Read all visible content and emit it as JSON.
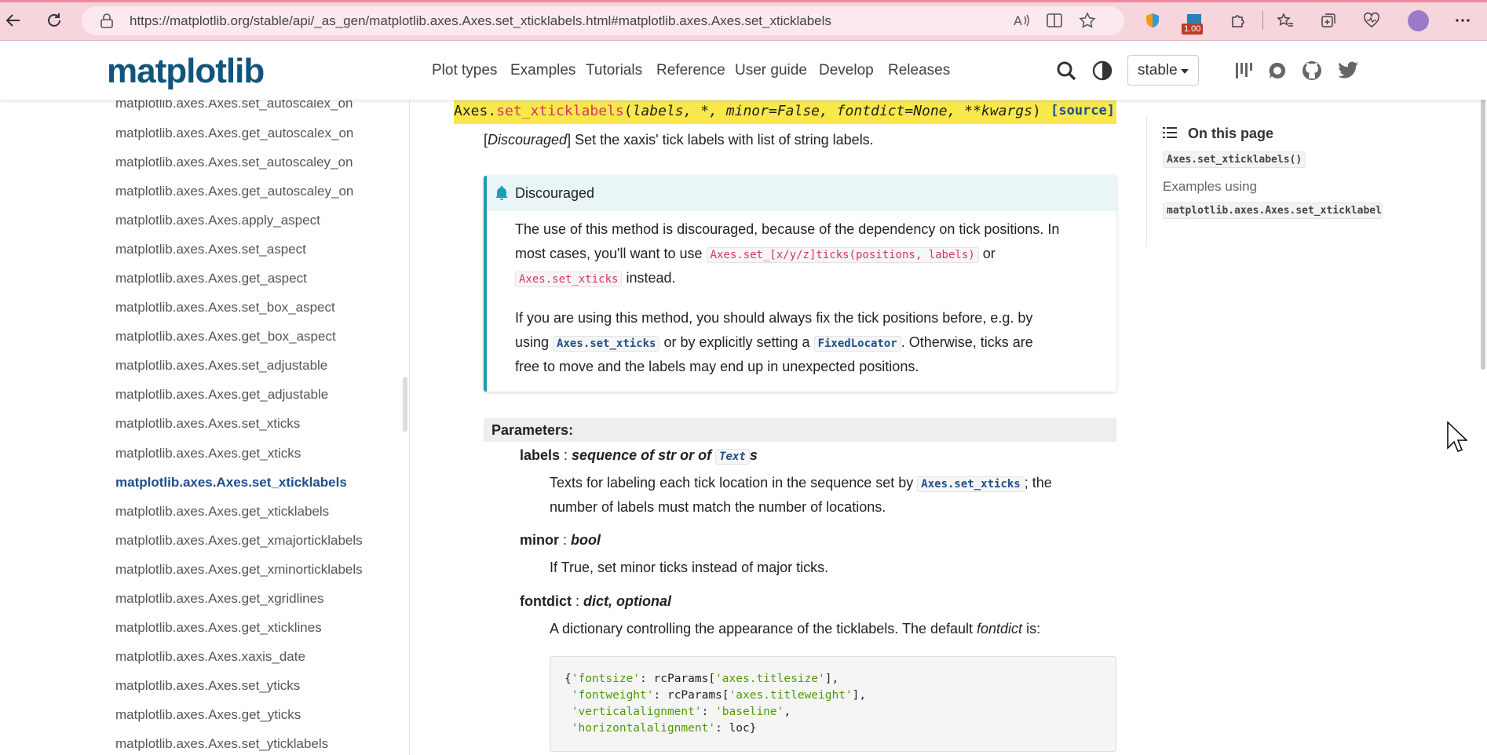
{
  "browser": {
    "url": "https://matplotlib.org/stable/api/_as_gen/matplotlib.axes.Axes.set_xticklabels.html#matplotlib.axes.Axes.set_xticklabels",
    "ext_badge": "1.00",
    "colors": {
      "chrome": "#f6d5dc",
      "accent": "#ee8aa0"
    }
  },
  "header": {
    "logo": "matplotlib",
    "nav": [
      "Plot types",
      "Examples",
      "Tutorials",
      "Reference",
      "User guide",
      "Develop",
      "Releases"
    ],
    "version": "stable"
  },
  "sidebar": {
    "items": [
      "matplotlib.axes.Axes.set_autoscalex_on",
      "matplotlib.axes.Axes.get_autoscalex_on",
      "matplotlib.axes.Axes.set_autoscaley_on",
      "matplotlib.axes.Axes.get_autoscaley_on",
      "matplotlib.axes.Axes.apply_aspect",
      "matplotlib.axes.Axes.set_aspect",
      "matplotlib.axes.Axes.get_aspect",
      "matplotlib.axes.Axes.set_box_aspect",
      "matplotlib.axes.Axes.get_box_aspect",
      "matplotlib.axes.Axes.set_adjustable",
      "matplotlib.axes.Axes.get_adjustable",
      "matplotlib.axes.Axes.set_xticks",
      "matplotlib.axes.Axes.get_xticks",
      "matplotlib.axes.Axes.set_xticklabels",
      "matplotlib.axes.Axes.get_xticklabels",
      "matplotlib.axes.Axes.get_xmajorticklabels",
      "matplotlib.axes.Axes.get_xminorticklabels",
      "matplotlib.axes.Axes.get_xgridlines",
      "matplotlib.axes.Axes.get_xticklines",
      "matplotlib.axes.Axes.xaxis_date",
      "matplotlib.axes.Axes.set_yticks",
      "matplotlib.axes.Axes.get_yticks",
      "matplotlib.axes.Axes.set_yticklabels"
    ],
    "active_index": 13
  },
  "main": {
    "sig_prefix": "Axes.",
    "sig_name": "set_xticklabels",
    "sig_args": "labels, *, minor=False, fontdict=None, **kwargs",
    "source": "[source]",
    "summary_tag": "Discouraged",
    "summary_text": " Set the xaxis' tick labels with list of string labels.",
    "admonition": {
      "title": "Discouraged",
      "p1_l1": "The use of this method is discouraged, because of the dependency on tick positions. In",
      "p1_l2a": "most cases, you'll want to use ",
      "p1_code1": "Axes.set_[x/y/z]ticks(positions, labels)",
      "p1_l2b": " or",
      "p1_code2": "Axes.set_xticks",
      "p1_l3b": " instead.",
      "p2_l1": "If you are using this method, you should always fix the tick positions before, e.g. by",
      "p2_l2a": "using ",
      "p2_code1": "Axes.set_xticks",
      "p2_l2b": " or by explicitly setting a ",
      "p2_code2": "FixedLocator",
      "p2_l2c": ". Otherwise, ticks are",
      "p2_l3": "free to move and the labels may end up in unexpected positions."
    },
    "params_title": "Parameters:",
    "params": {
      "labels_name": "labels",
      "labels_type": "sequence of str or of ",
      "labels_type_code": "Text",
      "labels_type_suffix": "s",
      "labels_d1a": "Texts for labeling each tick location in the sequence set by ",
      "labels_d1_code": "Axes.set_xticks",
      "labels_d1b": "; the",
      "labels_d2": "number of labels must match the number of locations.",
      "minor_name": "minor",
      "minor_type": "bool",
      "minor_desc": "If True, set minor ticks instead of major ticks.",
      "fontdict_name": "fontdict",
      "fontdict_type": "dict, optional",
      "fontdict_desc_a": "A dictionary controlling the appearance of the ticklabels. The default ",
      "fontdict_desc_em": "fontdict",
      "fontdict_desc_b": " is:",
      "sep": " : "
    },
    "code": {
      "l1_a": "{",
      "l1_k": "'fontsize'",
      "l1_b": ": rcParams[",
      "l1_v": "'axes.titlesize'",
      "l1_c": "],",
      "l2_k": "'fontweight'",
      "l2_b": ": rcParams[",
      "l2_v": "'axes.titleweight'",
      "l2_c": "],",
      "l3_k": "'verticalalignment'",
      "l3_b": ": ",
      "l3_v": "'baseline'",
      "l3_c": ",",
      "l4_k": "'horizontalalignment'",
      "l4_b": ": loc}"
    }
  },
  "toc": {
    "title": "On this page",
    "item1": "Axes.set_xticklabels()",
    "examples_label": "Examples using",
    "item2": "matplotlib.axes.Axes.set_xticklabels"
  }
}
